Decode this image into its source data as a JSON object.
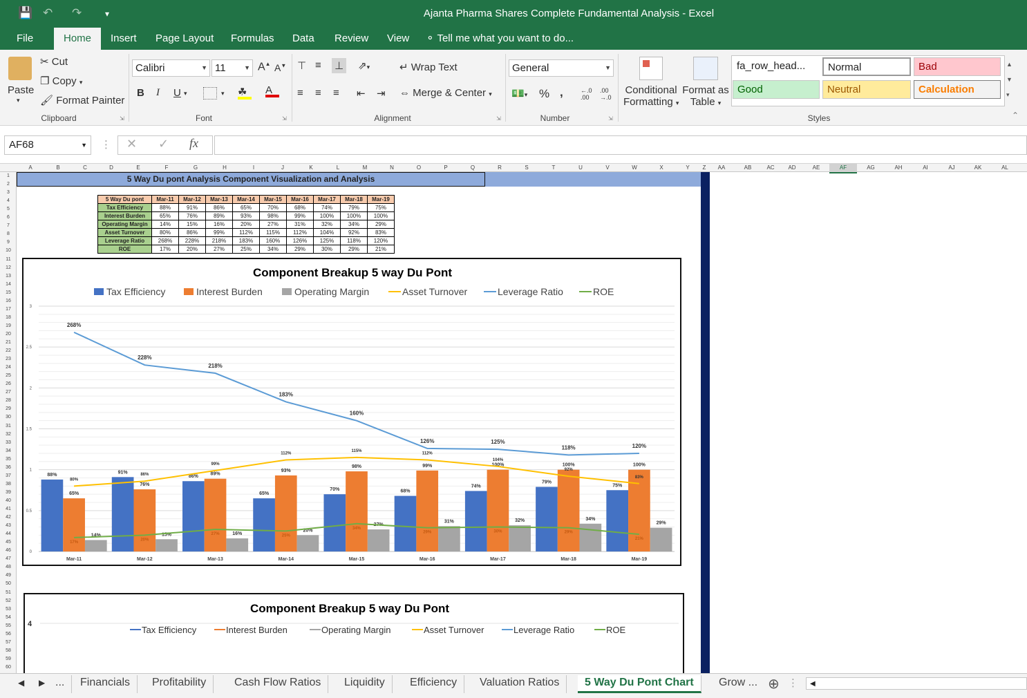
{
  "window": {
    "title": "Ajanta Pharma Shares Complete Fundamental Analysis - Excel"
  },
  "ribbon_tabs": [
    "File",
    "Home",
    "Insert",
    "Page Layout",
    "Formulas",
    "Data",
    "Review",
    "View",
    "Tell me what you want to do..."
  ],
  "clipboard": {
    "paste": "Paste",
    "cut": "Cut",
    "copy": "Copy",
    "format_painter": "Format Painter",
    "label": "Clipboard"
  },
  "font": {
    "name": "Calibri",
    "size": "11",
    "bold": "B",
    "italic": "I",
    "underline": "U",
    "label": "Font"
  },
  "alignment": {
    "wrap": "Wrap Text",
    "merge": "Merge & Center",
    "label": "Alignment"
  },
  "number": {
    "format": "General",
    "percent": "%",
    "comma": ",",
    "label": "Number"
  },
  "styles": {
    "conditional": "Conditional",
    "conditional2": "Formatting",
    "format_table": "Format as",
    "format_table2": "Table",
    "label": "Styles",
    "boxes": [
      {
        "name": "fa_row_head...",
        "bg": "#ffffff",
        "fg": "#222222"
      },
      {
        "name": "Normal",
        "bg": "#ffffff",
        "fg": "#222222"
      },
      {
        "name": "Bad",
        "bg": "#ffc7ce",
        "fg": "#9c0006"
      },
      {
        "name": "Good",
        "bg": "#c6efce",
        "fg": "#006100"
      },
      {
        "name": "Neutral",
        "bg": "#ffeb9c",
        "fg": "#9c5700"
      },
      {
        "name": "Calculation",
        "bg": "#f2f2f2",
        "fg": "#fa7d00"
      }
    ]
  },
  "formula_bar": {
    "namebox": "AF68",
    "fx": "fx",
    "value": ""
  },
  "columns": [
    "A",
    "B",
    "C",
    "D",
    "E",
    "F",
    "G",
    "H",
    "I",
    "J",
    "K",
    "L",
    "M",
    "N",
    "O",
    "P",
    "Q",
    "R",
    "S",
    "T",
    "U",
    "V",
    "W",
    "X",
    "Y",
    "Z",
    "AA",
    "AB",
    "AC",
    "AD",
    "AE",
    "AF",
    "AG",
    "AH",
    "AI",
    "AJ",
    "AK",
    "AL"
  ],
  "banner": "5 Way Du pont Analysis Component Visualization and Analysis",
  "table": {
    "header": [
      "5 Way Du pont",
      "Mar-11",
      "Mar-12",
      "Mar-13",
      "Mar-14",
      "Mar-15",
      "Mar-16",
      "Mar-17",
      "Mar-18",
      "Mar-19"
    ],
    "rows": [
      {
        "label": "Tax Efficiency",
        "values": [
          "88%",
          "91%",
          "86%",
          "65%",
          "70%",
          "68%",
          "74%",
          "79%",
          "75%"
        ]
      },
      {
        "label": "Interest Burden",
        "values": [
          "65%",
          "76%",
          "89%",
          "93%",
          "98%",
          "99%",
          "100%",
          "100%",
          "100%"
        ]
      },
      {
        "label": "Operating Margin",
        "values": [
          "14%",
          "15%",
          "16%",
          "20%",
          "27%",
          "31%",
          "32%",
          "34%",
          "29%"
        ]
      },
      {
        "label": "Asset Turnover",
        "values": [
          "80%",
          "86%",
          "99%",
          "112%",
          "115%",
          "112%",
          "104%",
          "92%",
          "83%"
        ]
      },
      {
        "label": "Leverage Ratio",
        "values": [
          "268%",
          "228%",
          "218%",
          "183%",
          "160%",
          "126%",
          "125%",
          "118%",
          "120%"
        ]
      },
      {
        "label": "ROE",
        "values": [
          "17%",
          "20%",
          "27%",
          "25%",
          "34%",
          "29%",
          "30%",
          "29%",
          "21%"
        ]
      }
    ]
  },
  "chart_data": [
    {
      "type": "bar",
      "title": "Component Breakup 5 way Du Pont",
      "categories": [
        "Mar-11",
        "Mar-12",
        "Mar-13",
        "Mar-14",
        "Mar-15",
        "Mar-16",
        "Mar-17",
        "Mar-18",
        "Mar-19"
      ],
      "ylim": [
        0,
        3
      ],
      "yticks": [
        "0",
        "0.5",
        "1",
        "1.5",
        "2",
        "2.5",
        "3"
      ],
      "grid": true,
      "legend": "top",
      "series": [
        {
          "name": "Tax Efficiency",
          "kind": "bar",
          "color": "#4472c4",
          "values": [
            0.88,
            0.91,
            0.86,
            0.65,
            0.7,
            0.68,
            0.74,
            0.79,
            0.75
          ],
          "labels": [
            "88%",
            "91%",
            "86%",
            "65%",
            "70%",
            "68%",
            "74%",
            "79%",
            "75%"
          ]
        },
        {
          "name": "Interest Burden",
          "kind": "bar",
          "color": "#ed7d31",
          "values": [
            0.65,
            0.76,
            0.89,
            0.93,
            0.98,
            0.99,
            1.0,
            1.0,
            1.0
          ],
          "labels": [
            "65%",
            "76%",
            "89%",
            "93%",
            "98%",
            "99%",
            "100%",
            "100%",
            "100%"
          ]
        },
        {
          "name": "Operating Margin",
          "kind": "bar",
          "color": "#a5a5a5",
          "values": [
            0.14,
            0.15,
            0.16,
            0.2,
            0.27,
            0.31,
            0.32,
            0.34,
            0.29
          ],
          "labels": [
            "14%",
            "15%",
            "16%",
            "20%",
            "27%",
            "31%",
            "32%",
            "34%",
            "29%"
          ]
        },
        {
          "name": "Asset Turnover",
          "kind": "line",
          "color": "#ffc000",
          "values": [
            0.8,
            0.86,
            0.99,
            1.12,
            1.15,
            1.12,
            1.04,
            0.92,
            0.83
          ],
          "labels": [
            "80%",
            "86%",
            "99%",
            "112%",
            "115%",
            "112%",
            "104%",
            "92%",
            "83%"
          ]
        },
        {
          "name": "Leverage Ratio",
          "kind": "line",
          "color": "#5b9bd5",
          "values": [
            2.68,
            2.28,
            2.18,
            1.83,
            1.6,
            1.26,
            1.25,
            1.18,
            1.2
          ],
          "labels": [
            "268%",
            "228%",
            "218%",
            "183%",
            "160%",
            "126%",
            "125%",
            "118%",
            "120%"
          ]
        },
        {
          "name": "ROE",
          "kind": "line",
          "color": "#70ad47",
          "values": [
            0.17,
            0.2,
            0.27,
            0.25,
            0.34,
            0.29,
            0.3,
            0.29,
            0.21
          ],
          "labels": [
            "17%",
            "20%",
            "27%",
            "25%",
            "34%",
            "29%",
            "30%",
            "29%",
            "21%"
          ]
        }
      ]
    },
    {
      "type": "line",
      "title": "Component Breakup 5 way Du Pont",
      "yticks": [
        "4"
      ],
      "legend": "top",
      "series": [
        {
          "name": "Tax Efficiency",
          "color": "#4472c4"
        },
        {
          "name": "Interest Burden",
          "color": "#ed7d31"
        },
        {
          "name": "Operating Margin",
          "color": "#a5a5a5"
        },
        {
          "name": "Asset Turnover",
          "color": "#ffc000"
        },
        {
          "name": "Leverage Ratio",
          "color": "#5b9bd5"
        },
        {
          "name": "ROE",
          "color": "#70ad47"
        }
      ]
    }
  ],
  "sheet_tabs": [
    "...",
    "Financials",
    "Profitability",
    "Cash Flow Ratios",
    "Liquidity",
    "Efficiency",
    "Valuation Ratios",
    "5 Way Du Pont Chart",
    "Grow ..."
  ],
  "active_sheet": "5 Way Du Pont Chart"
}
